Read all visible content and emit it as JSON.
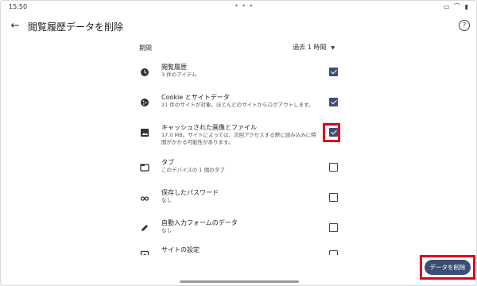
{
  "status_bar": {
    "time": "15:50",
    "dots": "• • •",
    "icons": [
      "▭",
      "⌒",
      "▮"
    ]
  },
  "toolbar": {
    "back": "←",
    "title": "閲覧履歴データを削除",
    "help": "?"
  },
  "period": {
    "label": "期間",
    "value": "過去 1 時間",
    "arrow": "▼"
  },
  "items": [
    {
      "title": "閲覧履歴",
      "subtitle": "3 件のアイテム",
      "icon": "history-icon",
      "checked": true
    },
    {
      "title": "Cookie とサイトデータ",
      "subtitle": "21 件のサイトが対象。ほとんどのサイトからログアウトします。",
      "icon": "cookie-icon",
      "checked": true
    },
    {
      "title": "キャッシュされた画像とファイル",
      "subtitle": "17.0 MB。サイトによっては、次回アクセスする際に読み込みに時間がかかる可能性があります。",
      "icon": "image-icon",
      "checked": true
    },
    {
      "title": "タブ",
      "subtitle": "このデバイスの 1 個のタブ",
      "icon": "tab-icon",
      "checked": false
    },
    {
      "title": "保存したパスワード",
      "subtitle": "なし",
      "icon": "key-icon",
      "checked": false
    },
    {
      "title": "自動入力フォームのデータ",
      "subtitle": "なし",
      "icon": "pencil-icon",
      "checked": false
    },
    {
      "title": "サイトの設定",
      "subtitle": "",
      "icon": "settings-icon",
      "checked": false
    }
  ],
  "actions": {
    "delete_label": "データを削除"
  },
  "colors": {
    "accent": "#3c4e73",
    "highlight": "#e0001a"
  }
}
